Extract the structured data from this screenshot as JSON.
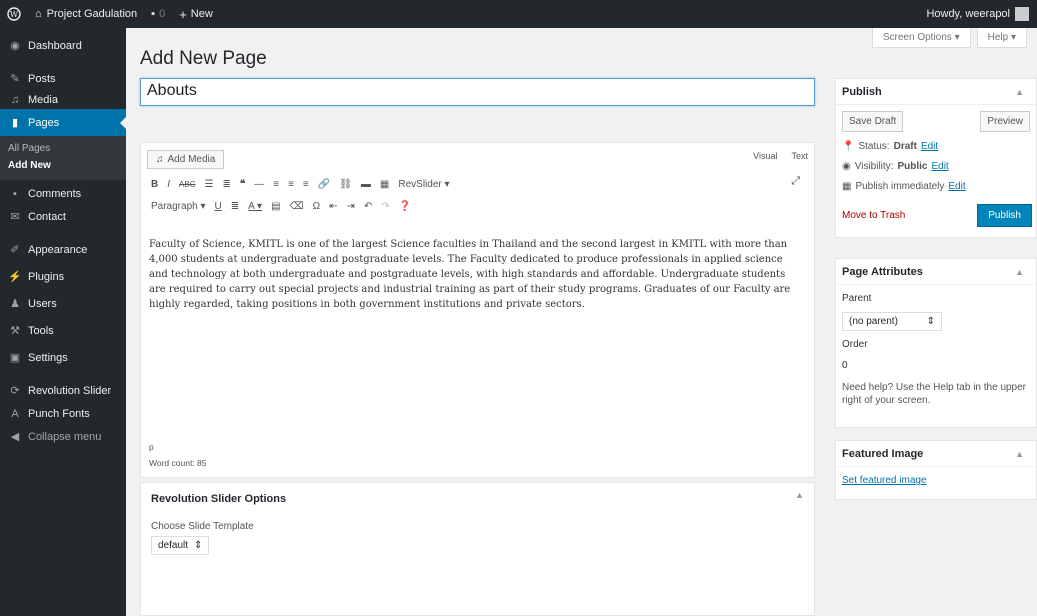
{
  "admin_bar": {
    "site_name": "Project Gadulation",
    "comments_count": "0",
    "new_label": "New",
    "greeting": "Howdy, weerapol"
  },
  "sidebar": {
    "items": [
      {
        "label": "Dashboard",
        "icon": "dashboard-icon"
      },
      {
        "label": "Posts",
        "icon": "pin-icon"
      },
      {
        "label": "Media",
        "icon": "media-icon"
      },
      {
        "label": "Pages",
        "icon": "page-icon"
      },
      {
        "label": "Comments",
        "icon": "comment-icon"
      },
      {
        "label": "Contact",
        "icon": "mail-icon"
      },
      {
        "label": "Appearance",
        "icon": "brush-icon"
      },
      {
        "label": "Plugins",
        "icon": "plug-icon"
      },
      {
        "label": "Users",
        "icon": "users-icon"
      },
      {
        "label": "Tools",
        "icon": "wrench-icon"
      },
      {
        "label": "Settings",
        "icon": "settings-icon"
      },
      {
        "label": "Revolution Slider",
        "icon": "refresh-icon"
      },
      {
        "label": "Punch Fonts",
        "icon": "font-icon"
      },
      {
        "label": "Collapse menu",
        "icon": "collapse-icon"
      }
    ],
    "submenu": {
      "all_pages": "All Pages",
      "add_new": "Add New"
    }
  },
  "screen_options": "Screen Options",
  "help": "Help",
  "page_title": "Add New Page",
  "post_title_value": "Abouts",
  "editor": {
    "add_media": "Add Media",
    "visual_tab": "Visual",
    "text_tab": "Text",
    "revslider_btn": "RevSlider",
    "paragraph_select": "Paragraph",
    "content": "Faculty of Science, KMITL is one of the largest Science faculties in Thailand and the second largest in KMITL with more than 4,000 students at undergraduate and postgraduate levels. The Faculty dedicated to produce professionals in applied science and technology at both undergraduate and postgraduate levels, with high standards and affordable. Undergraduate students are required to carry out special projects and industrial training as part of their study programs. Graduates of our Faculty are highly regarded, taking positions in both government institutions and private sectors.",
    "path": "p",
    "word_count": "Word count: 85"
  },
  "revslider_options": {
    "title": "Revolution Slider Options",
    "choose_label": "Choose Slide Template",
    "template_value": "default"
  },
  "publish": {
    "title": "Publish",
    "save_draft": "Save Draft",
    "preview": "Preview",
    "status_label": "Status:",
    "status_value": "Draft",
    "visibility_label": "Visibility:",
    "visibility_value": "Public",
    "publish_timing": "Publish immediately",
    "edit": "Edit",
    "move_to_trash": "Move to Trash",
    "publish_btn": "Publish"
  },
  "page_attributes": {
    "title": "Page Attributes",
    "parent_label": "Parent",
    "parent_value": "(no parent)",
    "order_label": "Order",
    "order_value": "0",
    "help_text": "Need help? Use the Help tab in the upper right of your screen."
  },
  "featured_image": {
    "title": "Featured Image",
    "set_link": "Set featured image"
  },
  "colors": {
    "admin_bar": "#23282d",
    "accent": "#0073aa",
    "publish_button": "#0085ba",
    "trash": "#a00000"
  }
}
